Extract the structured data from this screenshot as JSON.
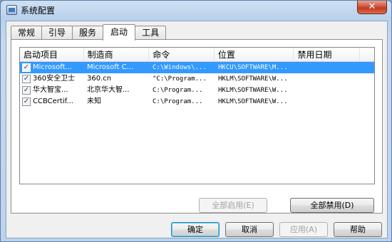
{
  "window": {
    "title": "系统配置",
    "close_glyph": "✕"
  },
  "tabs": [
    {
      "label": "常规",
      "active": false
    },
    {
      "label": "引导",
      "active": false
    },
    {
      "label": "服务",
      "active": false
    },
    {
      "label": "启动",
      "active": true
    },
    {
      "label": "工具",
      "active": false
    }
  ],
  "startup_list": {
    "columns": [
      "启动项目",
      "制造商",
      "命令",
      "位置",
      "禁用日期"
    ],
    "rows": [
      {
        "item": "Microsoft...",
        "vendor": "Microsoft C...",
        "command": "C:\\Windows\\...",
        "location": "HKCU\\SOFTWARE\\M...",
        "disabled_date": "",
        "checked": true,
        "selected": true
      },
      {
        "item": "360安全卫士",
        "vendor": "360.cn",
        "command": "\"C:\\Program...",
        "location": "HKLM\\SOFTWARE\\W...",
        "disabled_date": "",
        "checked": true,
        "selected": false
      },
      {
        "item": "华大智宝...",
        "vendor": "北京华大智...",
        "command": "C:\\Program...",
        "location": "HKLM\\SOFTWARE\\W...",
        "disabled_date": "",
        "checked": true,
        "selected": false
      },
      {
        "item": "CCBCertif...",
        "vendor": "未知",
        "command": "C:\\Program...",
        "location": "HKLM\\SOFTWARE\\W...",
        "disabled_date": "",
        "checked": true,
        "selected": false
      }
    ]
  },
  "buttons": {
    "enable_all": "全部启用(E)",
    "disable_all": "全部禁用(D)",
    "ok": "确定",
    "cancel": "取消",
    "apply": "应用(A)",
    "help": "帮助"
  },
  "colors": {
    "selection": "#3399ff",
    "close_button": "#c23a1e"
  },
  "icons": {
    "title": "msconfig-icon",
    "checkbox": "checkmark-icon"
  }
}
